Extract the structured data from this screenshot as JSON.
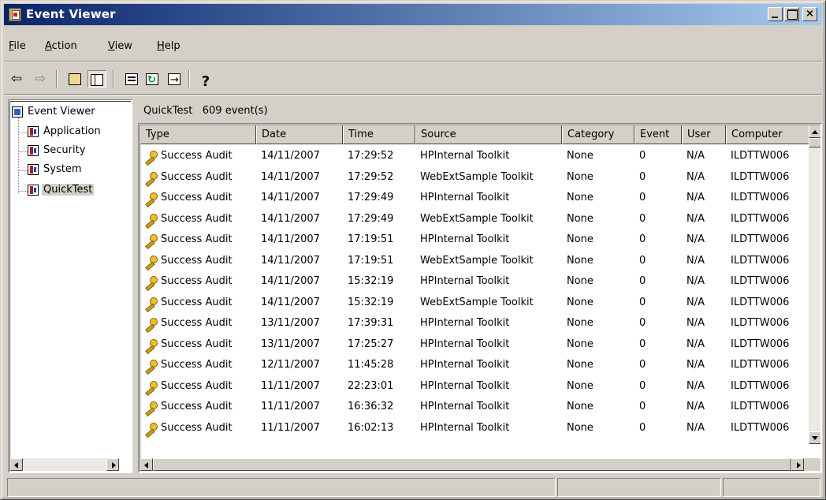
{
  "window": {
    "title": "Event Viewer",
    "icon": "event-viewer-icon"
  },
  "menubar": {
    "items": [
      {
        "label": "File",
        "accel": "F",
        "rest": "ile"
      },
      {
        "label": "Action",
        "accel": "A",
        "rest": "ction"
      },
      {
        "label": "View",
        "accel": "V",
        "rest": "iew"
      },
      {
        "label": "Help",
        "accel": "H",
        "rest": "elp"
      }
    ]
  },
  "toolbar": {
    "buttons": [
      "back-icon",
      "forward-icon",
      "up-folder-icon",
      "show-hide-tree-icon",
      "properties-icon",
      "refresh-icon",
      "export-list-icon",
      "help-icon"
    ]
  },
  "tree": {
    "root": "Event Viewer",
    "children": [
      "Application",
      "Security",
      "System",
      "QuickTest"
    ],
    "selected": "QuickTest"
  },
  "list": {
    "header_name": "QuickTest",
    "header_count": "609 event(s)",
    "columns": [
      "Type",
      "Date",
      "Time",
      "Source",
      "Category",
      "Event",
      "User",
      "Computer"
    ],
    "rows": [
      [
        "Success Audit",
        "14/11/2007",
        "17:29:52",
        "HPInternal Toolkit",
        "None",
        "0",
        "N/A",
        "ILDTTW006"
      ],
      [
        "Success Audit",
        "14/11/2007",
        "17:29:52",
        "WebExtSample Toolkit",
        "None",
        "0",
        "N/A",
        "ILDTTW006"
      ],
      [
        "Success Audit",
        "14/11/2007",
        "17:29:49",
        "HPInternal Toolkit",
        "None",
        "0",
        "N/A",
        "ILDTTW006"
      ],
      [
        "Success Audit",
        "14/11/2007",
        "17:29:49",
        "WebExtSample Toolkit",
        "None",
        "0",
        "N/A",
        "ILDTTW006"
      ],
      [
        "Success Audit",
        "14/11/2007",
        "17:19:51",
        "HPInternal Toolkit",
        "None",
        "0",
        "N/A",
        "ILDTTW006"
      ],
      [
        "Success Audit",
        "14/11/2007",
        "17:19:51",
        "WebExtSample Toolkit",
        "None",
        "0",
        "N/A",
        "ILDTTW006"
      ],
      [
        "Success Audit",
        "14/11/2007",
        "15:32:19",
        "HPInternal Toolkit",
        "None",
        "0",
        "N/A",
        "ILDTTW006"
      ],
      [
        "Success Audit",
        "14/11/2007",
        "15:32:19",
        "WebExtSample Toolkit",
        "None",
        "0",
        "N/A",
        "ILDTTW006"
      ],
      [
        "Success Audit",
        "13/11/2007",
        "17:39:31",
        "HPInternal Toolkit",
        "None",
        "0",
        "N/A",
        "ILDTTW006"
      ],
      [
        "Success Audit",
        "13/11/2007",
        "17:25:27",
        "HPInternal Toolkit",
        "None",
        "0",
        "N/A",
        "ILDTTW006"
      ],
      [
        "Success Audit",
        "12/11/2007",
        "11:45:28",
        "HPInternal Toolkit",
        "None",
        "0",
        "N/A",
        "ILDTTW006"
      ],
      [
        "Success Audit",
        "11/11/2007",
        "22:23:01",
        "HPInternal Toolkit",
        "None",
        "0",
        "N/A",
        "ILDTTW006"
      ],
      [
        "Success Audit",
        "11/11/2007",
        "16:36:32",
        "HPInternal Toolkit",
        "None",
        "0",
        "N/A",
        "ILDTTW006"
      ],
      [
        "Success Audit",
        "11/11/2007",
        "16:02:13",
        "HPInternal Toolkit",
        "None",
        "0",
        "N/A",
        "ILDTTW006"
      ]
    ]
  },
  "colors": {
    "titlebar_start": "#0a246a",
    "titlebar_end": "#a6caf0",
    "face": "#d4d0c8"
  }
}
